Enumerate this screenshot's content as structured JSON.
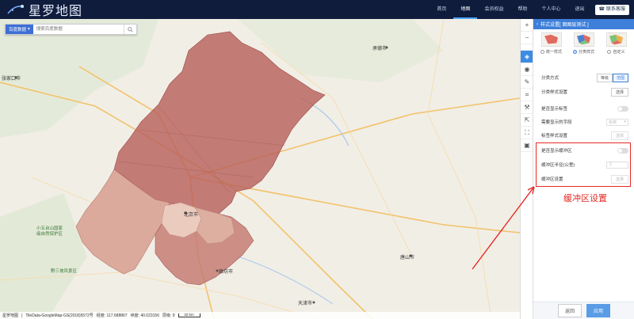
{
  "app": {
    "logo_text": "星罗地图"
  },
  "nav": {
    "items": [
      "首页",
      "地图",
      "会员权益",
      "帮助",
      "个人中心",
      "退出"
    ],
    "active_index": 1,
    "contact_label": "联系客服"
  },
  "search": {
    "source_label": "百度数据",
    "placeholder": "搜索百度数据"
  },
  "map": {
    "labels": {
      "zhangjiakou": "张家口市",
      "chengde": "承德市",
      "beijing": "北京市",
      "langfang": "廊坊市",
      "tianjin": "天津市",
      "tangshan": "唐山市",
      "park1": "小五台山国家",
      "park2": "级自然保护区",
      "park3": "野三坡风景区"
    }
  },
  "statusbar": {
    "logo": "星罗地图",
    "source": "TileData-GoogleMap-GS(2018)5572号",
    "lon": "经度: 117.688867",
    "lat": "纬度: 40.023156",
    "zoom": "层级: 9",
    "scale": "20 km"
  },
  "panel": {
    "title": "样式设置[ 面图层测试 ]",
    "styles": [
      {
        "label": "统一样式",
        "selected": false
      },
      {
        "label": "分类样式",
        "selected": true
      },
      {
        "label": "自定义",
        "selected": false
      }
    ],
    "classify_method_label": "分类方式",
    "classify_options": [
      "等级",
      "范围"
    ],
    "classify_selected": 1,
    "classify_style_label": "分类样式设置",
    "select_label": "选择",
    "show_label": "是否显示标签",
    "show_field_label": "需要显示的字段",
    "show_field_value": "名称",
    "label_style_label": "标签样式设置",
    "buffer_show_label": "是否显示缓冲区",
    "buffer_radius_label": "缓冲区半径(公里)",
    "buffer_radius_value": "2",
    "buffer_style_label": "缓冲区设置",
    "reset_label": "返回",
    "apply_label": "应用"
  },
  "annotation": {
    "text": "缓冲区设置"
  },
  "colors": {
    "accent": "#3d7fd9",
    "region_dark": "#b8625c",
    "region_light": "#d79d8f",
    "highlight": "#e52a24"
  }
}
